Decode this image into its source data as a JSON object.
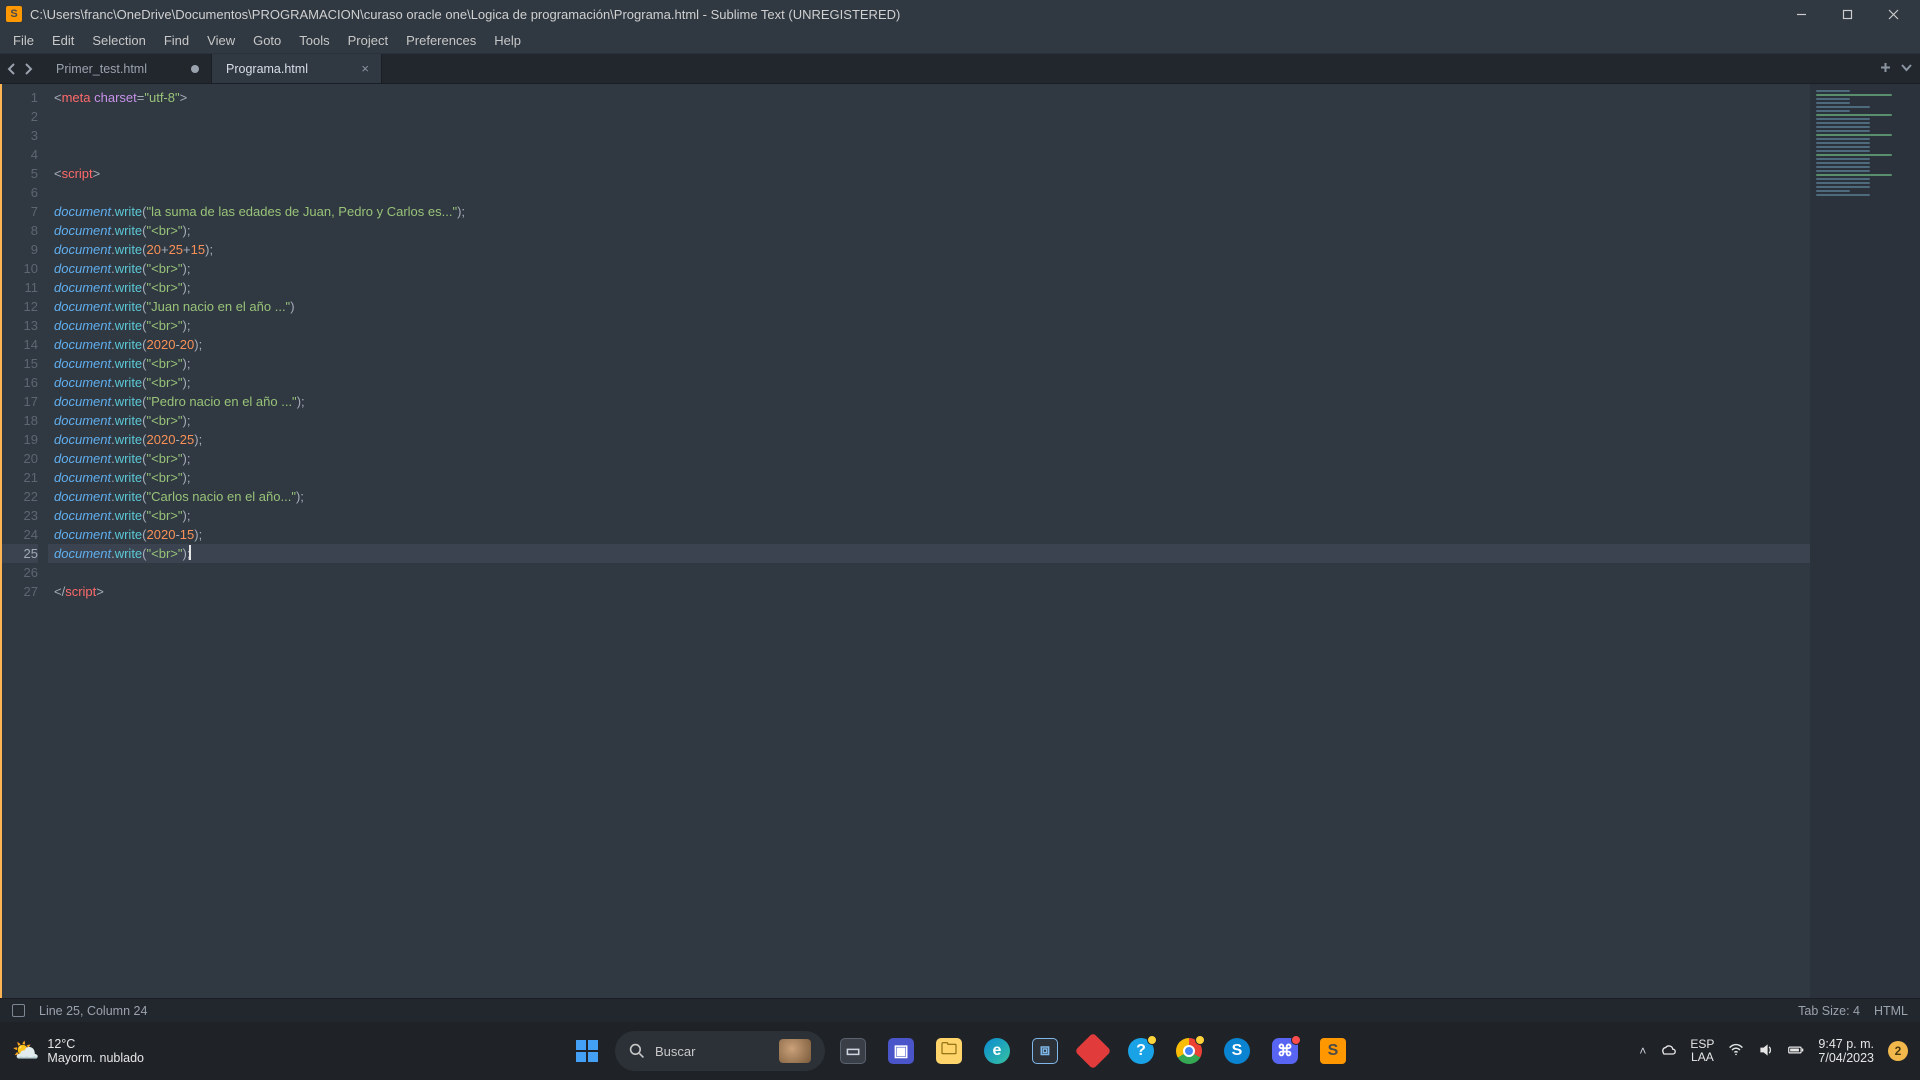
{
  "window": {
    "title": "C:\\Users\\franc\\OneDrive\\Documentos\\PROGRAMACION\\curaso oracle one\\Logica de programación\\Programa.html - Sublime Text (UNREGISTERED)"
  },
  "menu": [
    "File",
    "Edit",
    "Selection",
    "Find",
    "View",
    "Goto",
    "Tools",
    "Project",
    "Preferences",
    "Help"
  ],
  "tabs": [
    {
      "label": "Primer_test.html",
      "active": false,
      "dirty": true
    },
    {
      "label": "Programa.html",
      "active": true,
      "dirty": false
    }
  ],
  "editor": {
    "line_count": 27,
    "current_line": 25,
    "lines": [
      {
        "n": 1,
        "tokens": [
          [
            "punc",
            "<"
          ],
          [
            "tag",
            "meta"
          ],
          [
            "punc",
            " "
          ],
          [
            "attr",
            "charset"
          ],
          [
            "punc",
            "="
          ],
          [
            "str",
            "\"utf-8\""
          ],
          [
            "punc",
            ">"
          ]
        ]
      },
      {
        "n": 2,
        "tokens": []
      },
      {
        "n": 3,
        "tokens": []
      },
      {
        "n": 4,
        "tokens": []
      },
      {
        "n": 5,
        "tokens": [
          [
            "punc",
            "<"
          ],
          [
            "tag",
            "script"
          ],
          [
            "punc",
            ">"
          ]
        ]
      },
      {
        "n": 6,
        "tokens": []
      },
      {
        "n": 7,
        "tokens": [
          [
            "obj",
            "document"
          ],
          [
            "punc",
            "."
          ],
          [
            "func",
            "write"
          ],
          [
            "punc",
            "("
          ],
          [
            "str",
            "\"la suma de las edades de Juan, Pedro y Carlos es...\""
          ],
          [
            "punc",
            ");"
          ]
        ]
      },
      {
        "n": 8,
        "tokens": [
          [
            "obj",
            "document"
          ],
          [
            "punc",
            "."
          ],
          [
            "func",
            "write"
          ],
          [
            "punc",
            "("
          ],
          [
            "str",
            "\"<br>\""
          ],
          [
            "punc",
            ");"
          ]
        ]
      },
      {
        "n": 9,
        "tokens": [
          [
            "obj",
            "document"
          ],
          [
            "punc",
            "."
          ],
          [
            "func",
            "write"
          ],
          [
            "punc",
            "("
          ],
          [
            "num",
            "20"
          ],
          [
            "punc",
            "+"
          ],
          [
            "num",
            "25"
          ],
          [
            "punc",
            "+"
          ],
          [
            "num",
            "15"
          ],
          [
            "punc",
            ");"
          ]
        ]
      },
      {
        "n": 10,
        "tokens": [
          [
            "obj",
            "document"
          ],
          [
            "punc",
            "."
          ],
          [
            "func",
            "write"
          ],
          [
            "punc",
            "("
          ],
          [
            "str",
            "\"<br>\""
          ],
          [
            "punc",
            ");"
          ]
        ]
      },
      {
        "n": 11,
        "tokens": [
          [
            "obj",
            "document"
          ],
          [
            "punc",
            "."
          ],
          [
            "func",
            "write"
          ],
          [
            "punc",
            "("
          ],
          [
            "str",
            "\"<br>\""
          ],
          [
            "punc",
            ");"
          ]
        ]
      },
      {
        "n": 12,
        "tokens": [
          [
            "obj",
            "document"
          ],
          [
            "punc",
            "."
          ],
          [
            "func",
            "write"
          ],
          [
            "punc",
            "("
          ],
          [
            "str",
            "\"Juan nacio en el año ...\""
          ],
          [
            "punc",
            ")"
          ]
        ]
      },
      {
        "n": 13,
        "tokens": [
          [
            "obj",
            "document"
          ],
          [
            "punc",
            "."
          ],
          [
            "func",
            "write"
          ],
          [
            "punc",
            "("
          ],
          [
            "str",
            "\"<br>\""
          ],
          [
            "punc",
            ");"
          ]
        ]
      },
      {
        "n": 14,
        "tokens": [
          [
            "obj",
            "document"
          ],
          [
            "punc",
            "."
          ],
          [
            "func",
            "write"
          ],
          [
            "punc",
            "("
          ],
          [
            "num",
            "2020"
          ],
          [
            "punc",
            "-"
          ],
          [
            "num",
            "20"
          ],
          [
            "punc",
            ");"
          ]
        ]
      },
      {
        "n": 15,
        "tokens": [
          [
            "obj",
            "document"
          ],
          [
            "punc",
            "."
          ],
          [
            "func",
            "write"
          ],
          [
            "punc",
            "("
          ],
          [
            "str",
            "\"<br>\""
          ],
          [
            "punc",
            ");"
          ]
        ]
      },
      {
        "n": 16,
        "tokens": [
          [
            "obj",
            "document"
          ],
          [
            "punc",
            "."
          ],
          [
            "func",
            "write"
          ],
          [
            "punc",
            "("
          ],
          [
            "str",
            "\"<br>\""
          ],
          [
            "punc",
            ");"
          ]
        ]
      },
      {
        "n": 17,
        "tokens": [
          [
            "obj",
            "document"
          ],
          [
            "punc",
            "."
          ],
          [
            "func",
            "write"
          ],
          [
            "punc",
            "("
          ],
          [
            "str",
            "\"Pedro nacio en el año ...\""
          ],
          [
            "punc",
            ");"
          ]
        ]
      },
      {
        "n": 18,
        "tokens": [
          [
            "obj",
            "document"
          ],
          [
            "punc",
            "."
          ],
          [
            "func",
            "write"
          ],
          [
            "punc",
            "("
          ],
          [
            "str",
            "\"<br>\""
          ],
          [
            "punc",
            ");"
          ]
        ]
      },
      {
        "n": 19,
        "tokens": [
          [
            "obj",
            "document"
          ],
          [
            "punc",
            "."
          ],
          [
            "func",
            "write"
          ],
          [
            "punc",
            "("
          ],
          [
            "num",
            "2020"
          ],
          [
            "punc",
            "-"
          ],
          [
            "num",
            "25"
          ],
          [
            "punc",
            ");"
          ]
        ]
      },
      {
        "n": 20,
        "tokens": [
          [
            "obj",
            "document"
          ],
          [
            "punc",
            "."
          ],
          [
            "func",
            "write"
          ],
          [
            "punc",
            "("
          ],
          [
            "str",
            "\"<br>\""
          ],
          [
            "punc",
            ");"
          ]
        ]
      },
      {
        "n": 21,
        "tokens": [
          [
            "obj",
            "document"
          ],
          [
            "punc",
            "."
          ],
          [
            "func",
            "write"
          ],
          [
            "punc",
            "("
          ],
          [
            "str",
            "\"<br>\""
          ],
          [
            "punc",
            ");"
          ]
        ]
      },
      {
        "n": 22,
        "tokens": [
          [
            "obj",
            "document"
          ],
          [
            "punc",
            "."
          ],
          [
            "func",
            "write"
          ],
          [
            "punc",
            "("
          ],
          [
            "str",
            "\"Carlos nacio en el año...\""
          ],
          [
            "punc",
            ");"
          ]
        ]
      },
      {
        "n": 23,
        "tokens": [
          [
            "obj",
            "document"
          ],
          [
            "punc",
            "."
          ],
          [
            "func",
            "write"
          ],
          [
            "punc",
            "("
          ],
          [
            "str",
            "\"<br>\""
          ],
          [
            "punc",
            ");"
          ]
        ]
      },
      {
        "n": 24,
        "tokens": [
          [
            "obj",
            "document"
          ],
          [
            "punc",
            "."
          ],
          [
            "func",
            "write"
          ],
          [
            "punc",
            "("
          ],
          [
            "num",
            "2020"
          ],
          [
            "punc",
            "-"
          ],
          [
            "num",
            "15"
          ],
          [
            "punc",
            ");"
          ]
        ]
      },
      {
        "n": 25,
        "tokens": [
          [
            "obj",
            "document"
          ],
          [
            "punc",
            "."
          ],
          [
            "func",
            "write"
          ],
          [
            "punc",
            "("
          ],
          [
            "str",
            "\"<br>\""
          ],
          [
            "punc",
            ");"
          ]
        ]
      },
      {
        "n": 26,
        "tokens": []
      },
      {
        "n": 27,
        "tokens": [
          [
            "punc",
            "</"
          ],
          [
            "tag",
            "script"
          ],
          [
            "punc",
            ">"
          ]
        ]
      }
    ]
  },
  "status": {
    "left": "Line 25, Column 24",
    "tabsize": "Tab Size: 4",
    "syntax": "HTML"
  },
  "taskbar": {
    "weather_temp": "12°C",
    "weather_desc": "Mayorm. nublado",
    "search_placeholder": "Buscar",
    "lang_top": "ESP",
    "lang_bot": "LAA",
    "time": "9:47 p. m.",
    "date": "7/04/2023",
    "notif_count": "2"
  }
}
